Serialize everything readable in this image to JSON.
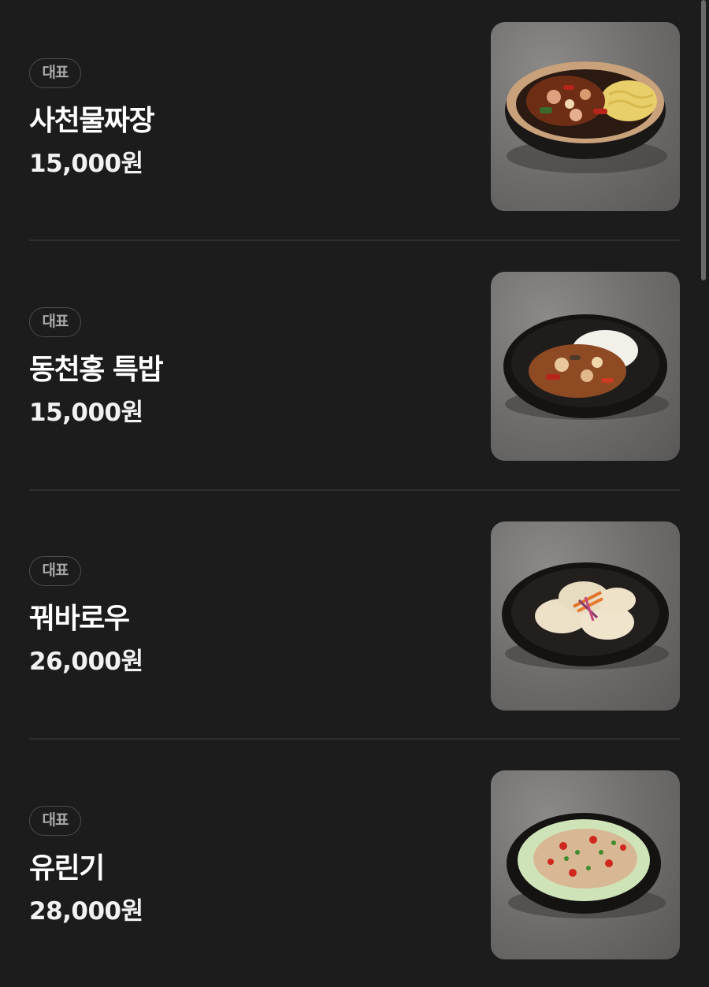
{
  "menu": {
    "items": [
      {
        "badge": "대표",
        "name": "사천물짜장",
        "price": "15,000원",
        "dish_icon": "jjajang-noodle-bowl-photo"
      },
      {
        "badge": "대표",
        "name": "동천홍 특밥",
        "price": "15,000원",
        "dish_icon": "rice-bowl-photo"
      },
      {
        "badge": "대표",
        "name": "꿔바로우",
        "price": "26,000원",
        "dish_icon": "sweet-sour-pork-plate-photo"
      },
      {
        "badge": "대표",
        "name": "유린기",
        "price": "28,000원",
        "dish_icon": "fried-chicken-salad-plate-photo"
      }
    ]
  },
  "colors": {
    "background": "#1c1c1d",
    "divider": "#2e2e30",
    "badge_border": "#4c4c4f",
    "badge_text": "#a8a8ab",
    "text": "#ffffff"
  }
}
